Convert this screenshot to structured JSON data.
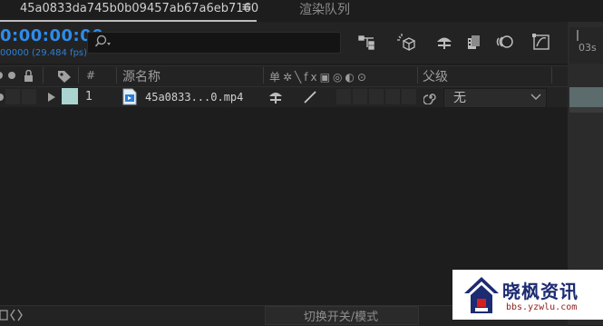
{
  "tabs": {
    "comp_title": "45a0833da745b0b09457ab67a6eb7160",
    "menu_glyph": "≡",
    "render_queue": "渲染队列"
  },
  "header": {
    "timecode": "0:00:00:00",
    "fps": "00000 (29.484 fps)",
    "search_icon": "search-icon"
  },
  "toolbar_icons": [
    "comp-flowchart-icon",
    "draft-3d-icon",
    "shy-layers-icon",
    "frame-blending-icon",
    "motion-blur-icon",
    "graph-editor-icon"
  ],
  "ruler": {
    "label": "03s"
  },
  "columns": {
    "num": "#",
    "source_name": "源名称",
    "switches": "单✲╲fx▣◎◐⊙",
    "parent": "父级"
  },
  "layer": {
    "number": "1",
    "name": "45a0833...0.mp4",
    "label_color": "#a9d4d0",
    "parent_value": "无"
  },
  "bottom": {
    "mode_toggle": "切换开关/模式"
  },
  "watermark": {
    "main": "晓枫资讯",
    "sub": "bbs.yzwlu.com"
  }
}
